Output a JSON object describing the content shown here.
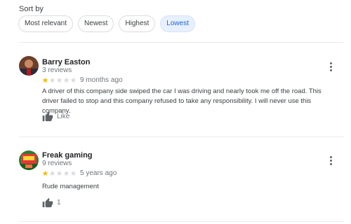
{
  "sort": {
    "label": "Sort by",
    "options": [
      "Most relevant",
      "Newest",
      "Highest",
      "Lowest"
    ],
    "selected": "Lowest"
  },
  "reviews": [
    {
      "name": "Barry Easton",
      "count": "3 reviews",
      "rating": 1,
      "max_rating": 5,
      "date": "9 months ago",
      "text": "A driver of this company side swiped the car I was driving and nearly took me off the road.  This driver failed to stop and this company refused to take any responsibility. I will never use this company.",
      "like_label": "Like"
    },
    {
      "name": "Freak gaming",
      "count": "9 reviews",
      "rating": 1,
      "max_rating": 5,
      "date": "5 years ago",
      "text": "Rude management",
      "like_label": "1"
    }
  ],
  "colors": {
    "star_filled": "#fbbc04",
    "star_empty": "#dadce0",
    "accent": "#1967d2",
    "chip_selected_bg": "#e8f0fe"
  }
}
